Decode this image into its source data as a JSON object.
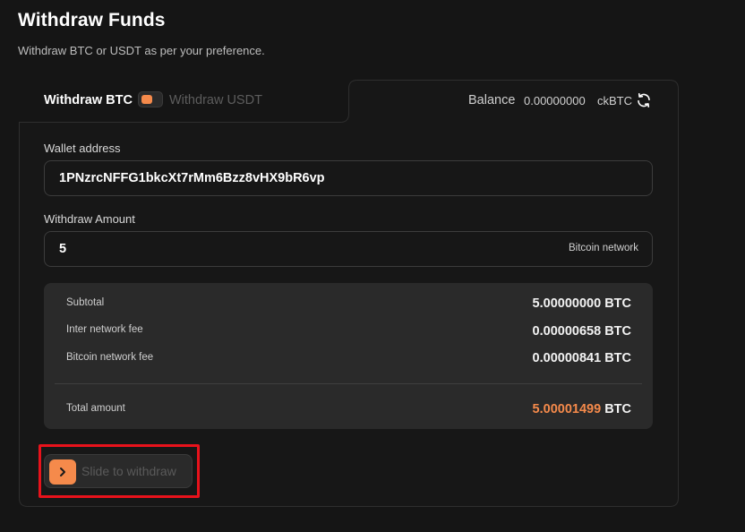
{
  "header": {
    "title": "Withdraw Funds",
    "subtitle": "Withdraw BTC or USDT as per your preference."
  },
  "tabs": {
    "active_label": "Withdraw BTC",
    "inactive_label": "Withdraw USDT"
  },
  "balance": {
    "label": "Balance",
    "value": "0.00000000",
    "unit": "ckBTC"
  },
  "wallet": {
    "label": "Wallet address",
    "value": "1PNzrcNFFG1bkcXt7rMm6Bzz8vHX9bR6vp"
  },
  "amount": {
    "label": "Withdraw Amount",
    "value": "5",
    "network": "Bitcoin network"
  },
  "summary": {
    "rows": [
      {
        "label": "Subtotal",
        "value": "5.00000000",
        "unit": "BTC"
      },
      {
        "label": "Inter network fee",
        "value": "0.00000658",
        "unit": "BTC"
      },
      {
        "label": "Bitcoin network fee",
        "value": "0.00000841",
        "unit": "BTC"
      }
    ],
    "total_label": "Total amount",
    "total_value": "5.00001499",
    "total_unit": "BTC"
  },
  "slider": {
    "label": "Slide to withdraw"
  },
  "colors": {
    "accent": "#f58a4b",
    "background": "#151515",
    "highlight": "#e8121b"
  }
}
